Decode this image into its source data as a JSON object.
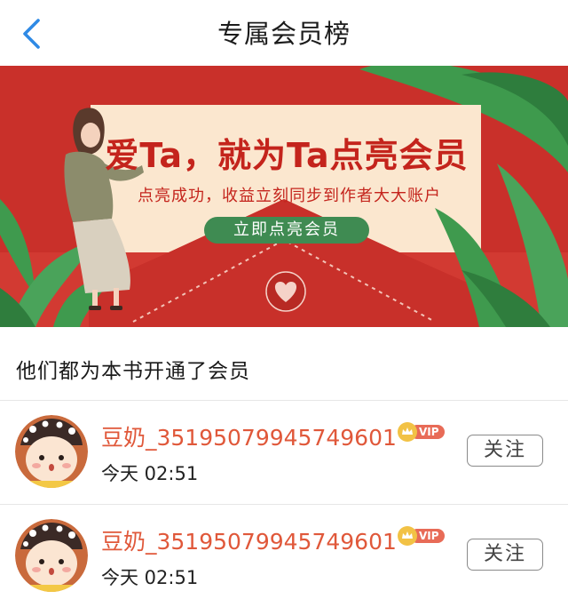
{
  "header": {
    "title": "专属会员榜"
  },
  "banner": {
    "headline": "爱Ta，就为Ta点亮会员",
    "subline": "点亮成功，收益立刻同步到作者大大账户",
    "cta_label": "立即点亮会员"
  },
  "section": {
    "title": "他们都为本书开通了会员"
  },
  "members": [
    {
      "name": "豆奶_35195079945749601",
      "vip_label": "VIP",
      "time": "今天 02:51",
      "follow_label": "关注"
    },
    {
      "name": "豆奶_35195079945749601",
      "vip_label": "VIP",
      "time": "今天 02:51",
      "follow_label": "关注"
    }
  ],
  "colors": {
    "accent_blue": "#2f8ae5",
    "banner_red": "#c9302a",
    "name_orange": "#e0583a",
    "cta_green": "#3f8b52",
    "vip_pink": "#e86b57",
    "crown_gold": "#f2c245"
  },
  "icons": {
    "back": "chevron-left-icon",
    "crown": "crown-icon",
    "heart_seal": "heart-seal-icon"
  }
}
